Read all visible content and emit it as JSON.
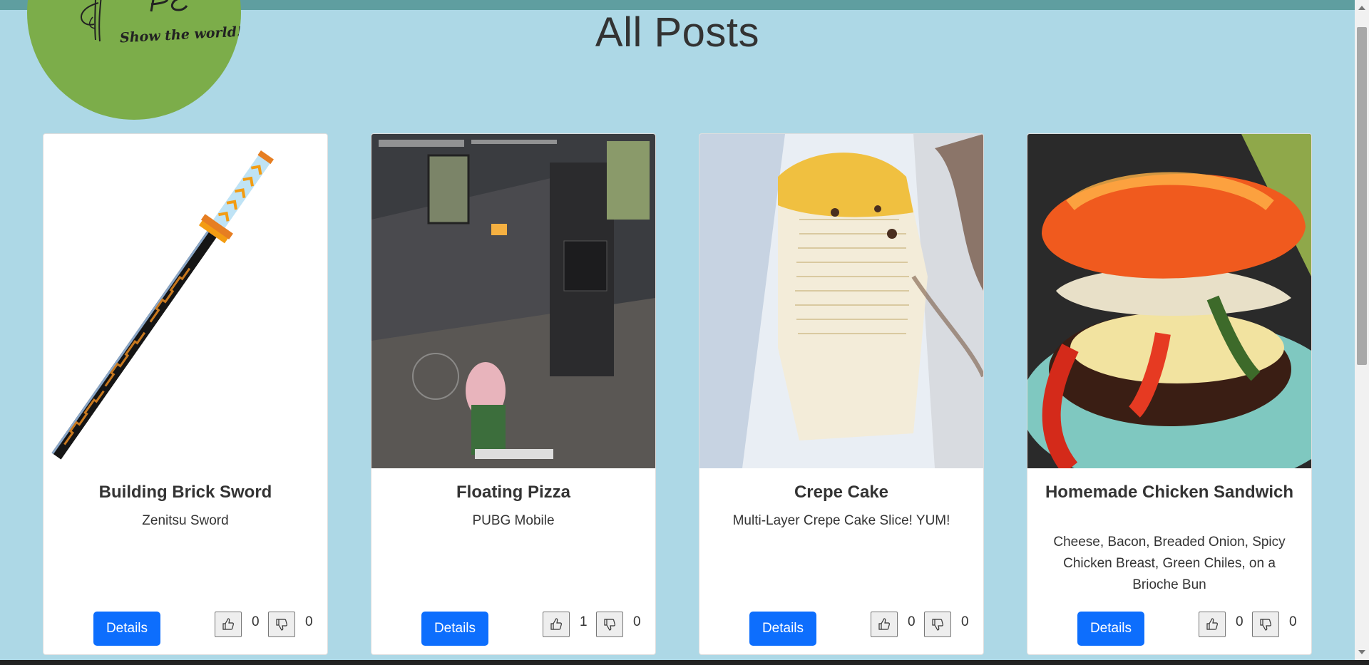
{
  "logo": {
    "monogram": "PC",
    "tagline": "Show the world!"
  },
  "page": {
    "title": "All Posts"
  },
  "posts": [
    {
      "title": "Building Brick Sword",
      "description": "Zenitsu Sword",
      "details_label": "Details",
      "likes": "0",
      "dislikes": "0"
    },
    {
      "title": "Floating Pizza",
      "description": "PUBG Mobile",
      "details_label": "Details",
      "likes": "1",
      "dislikes": "0"
    },
    {
      "title": "Crepe Cake",
      "description": "Multi-Layer Crepe Cake Slice! YUM!",
      "details_label": "Details",
      "likes": "0",
      "dislikes": "0"
    },
    {
      "title": "Homemade Chicken Sandwich",
      "description": "Cheese, Bacon, Breaded Onion, Spicy Chicken Breast, Green Chiles, on a Brioche Bun",
      "details_label": "Details",
      "likes": "0",
      "dislikes": "0"
    }
  ],
  "icons": {
    "like": "thumbs-up-icon",
    "dislike": "thumbs-down-icon"
  },
  "colors": {
    "background": "#add8e6",
    "topbar": "#5f9ea0",
    "logo_circle": "#7cad4a",
    "button": "#0d6efd"
  }
}
